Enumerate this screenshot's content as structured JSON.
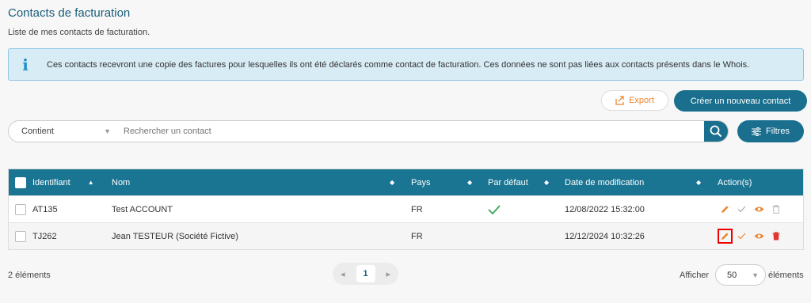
{
  "header": {
    "title": "Contacts de facturation",
    "subtitle": "Liste de mes contacts de facturation."
  },
  "info": {
    "icon": "info-icon",
    "text": "Ces contacts recevront une copie des factures pour lesquelles ils ont été déclarés comme contact de facturation. Ces données ne sont pas liées aux contacts présents dans le Whois."
  },
  "toolbar": {
    "export_label": "Export",
    "create_label": "Créer un nouveau contact",
    "filters_label": "Filtres"
  },
  "search": {
    "mode": "Contient",
    "placeholder": "Rechercher un contact"
  },
  "table": {
    "columns": {
      "id": "Identifiant",
      "name": "Nom",
      "country": "Pays",
      "default": "Par défaut",
      "modified": "Date de modification",
      "actions": "Action(s)"
    },
    "rows": [
      {
        "id": "AT135",
        "name": "Test ACCOUNT",
        "country": "FR",
        "default": true,
        "modified": "12/08/2022 15:32:00"
      },
      {
        "id": "TJ262",
        "name": "Jean TESTEUR (Société Fictive)",
        "country": "FR",
        "default": false,
        "modified": "12/12/2024 10:32:26"
      }
    ]
  },
  "footer": {
    "count": "2 éléments",
    "page": "1",
    "per_page_label": "Afficher",
    "per_page_value": "50",
    "per_page_suffix": "éléments"
  },
  "colors": {
    "primary": "#1a6f8e",
    "accent_orange": "#ee8631",
    "check_green": "#3aa35a",
    "delete_red": "#e0342f"
  }
}
